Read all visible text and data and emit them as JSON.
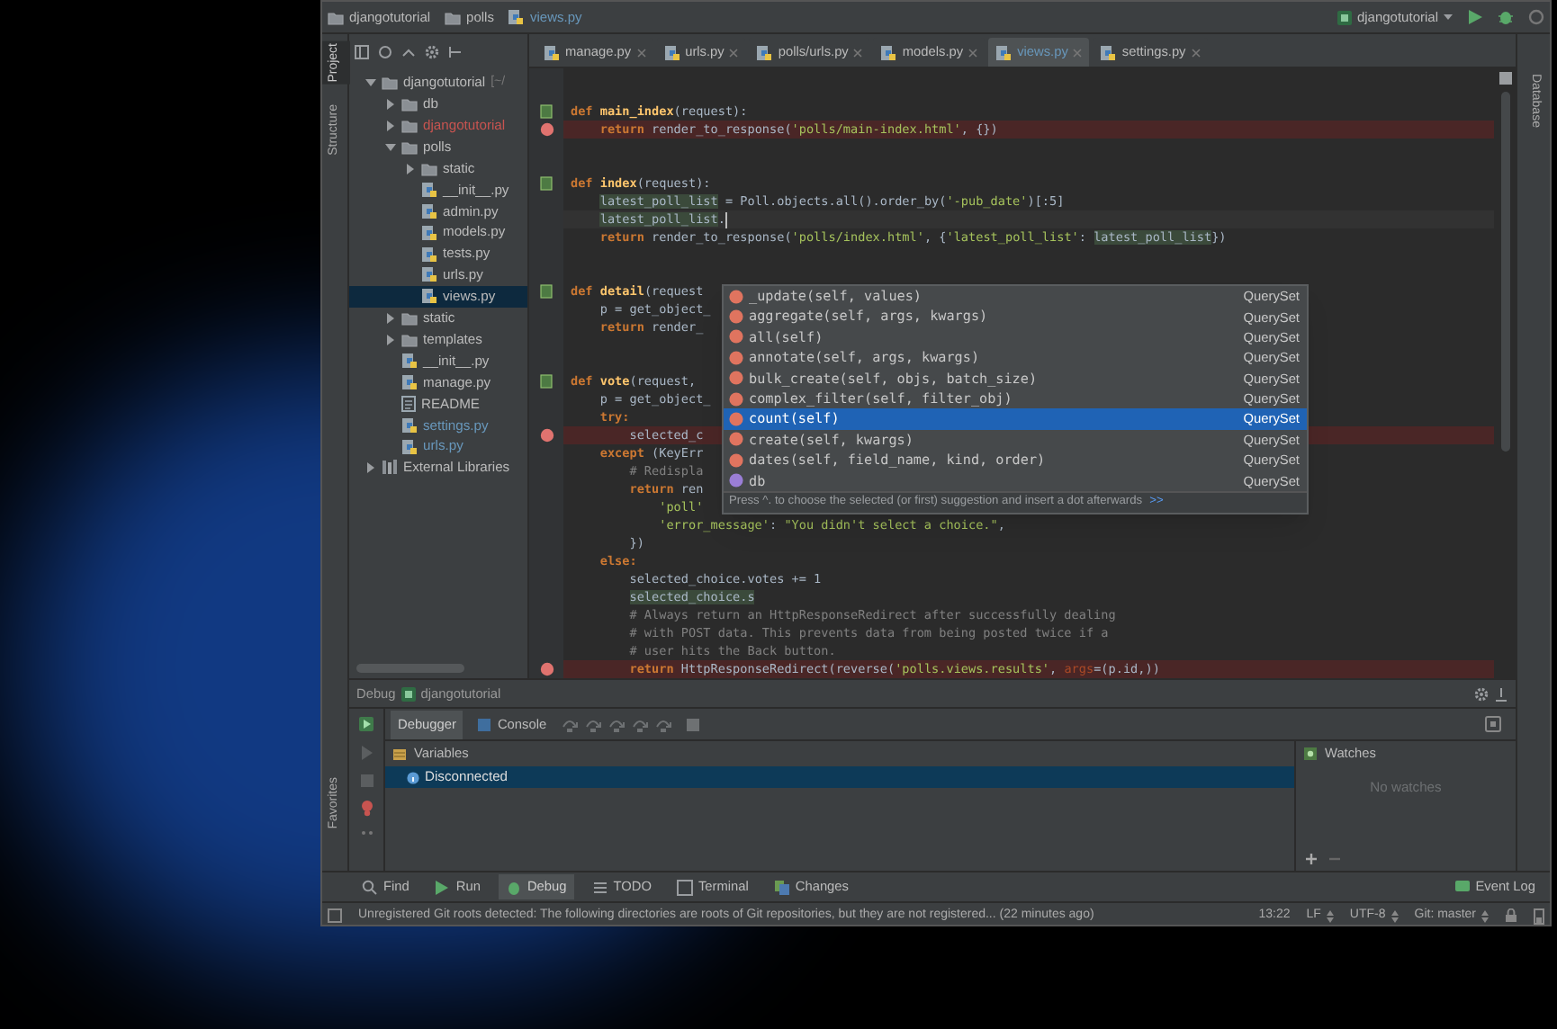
{
  "navbar": {
    "breadcrumbs": [
      {
        "label": "djangotutorial",
        "kind": "folder"
      },
      {
        "label": "polls",
        "kind": "folder"
      },
      {
        "label": "views.py",
        "kind": "python"
      }
    ],
    "run_config": "djangotutorial"
  },
  "left_tabs": [
    {
      "label": "Project",
      "selected": true
    },
    {
      "label": "Structure",
      "selected": false
    }
  ],
  "favorites_tab": "Favorites",
  "right_tabs": [
    "Database"
  ],
  "project_tree": [
    {
      "label": "djangotutorial",
      "path": "[~/",
      "kind": "folder",
      "expanded": true,
      "selected": false,
      "children": [
        {
          "label": "db",
          "kind": "folder",
          "expanded": false,
          "selected": false
        },
        {
          "label": "djangotutorial",
          "kind": "folder",
          "expanded": false,
          "selected": false,
          "color": "#c75450"
        },
        {
          "label": "polls",
          "kind": "folder",
          "expanded": true,
          "selected": false,
          "children": [
            {
              "label": "static",
              "kind": "folder",
              "expanded": false,
              "selected": false
            },
            {
              "label": "__init__.py",
              "kind": "python",
              "selected": false
            },
            {
              "label": "admin.py",
              "kind": "python",
              "selected": false
            },
            {
              "label": "models.py",
              "kind": "python",
              "selected": false
            },
            {
              "label": "tests.py",
              "kind": "python",
              "selected": false
            },
            {
              "label": "urls.py",
              "kind": "python",
              "selected": false
            },
            {
              "label": "views.py",
              "kind": "python",
              "selected": true
            }
          ]
        },
        {
          "label": "static",
          "kind": "folder",
          "expanded": false,
          "selected": false
        },
        {
          "label": "templates",
          "kind": "folder",
          "expanded": false,
          "selected": false
        },
        {
          "label": "__init__.py",
          "kind": "python",
          "selected": false
        },
        {
          "label": "manage.py",
          "kind": "python",
          "selected": false
        },
        {
          "label": "README",
          "kind": "text",
          "selected": false
        },
        {
          "label": "settings.py",
          "kind": "python",
          "selected": false,
          "color": "#6897bb"
        },
        {
          "label": "urls.py",
          "kind": "python",
          "selected": false,
          "color": "#6897bb"
        }
      ]
    },
    {
      "label": "External Libraries",
      "kind": "library",
      "expanded": false,
      "selected": false
    }
  ],
  "editor_tabs": [
    {
      "label": "manage.py",
      "selected": false
    },
    {
      "label": "urls.py",
      "selected": false
    },
    {
      "label": "polls/urls.py",
      "selected": false
    },
    {
      "label": "models.py",
      "selected": false
    },
    {
      "label": "views.py",
      "selected": true
    },
    {
      "label": "settings.py",
      "selected": false
    }
  ],
  "code_lines": [
    {
      "marker": true,
      "breakpoint": false,
      "current": false,
      "segments": [
        {
          "kind": "kw",
          "text": "def "
        },
        {
          "kind": "fn",
          "text": "main_index"
        },
        {
          "kind": "plain",
          "text": "(request):"
        }
      ]
    },
    {
      "marker": false,
      "breakpoint": true,
      "current": false,
      "segments": [
        {
          "kind": "kw",
          "text": "    return "
        },
        {
          "kind": "plain",
          "text": "render_to_response("
        },
        {
          "kind": "str",
          "text": "'polls/main-index.html'"
        },
        {
          "kind": "plain",
          "text": ", {})"
        }
      ]
    },
    {
      "marker": false,
      "breakpoint": false,
      "current": false
    },
    {
      "marker": false,
      "breakpoint": false,
      "current": false
    },
    {
      "marker": true,
      "breakpoint": false,
      "current": false,
      "segments": [
        {
          "kind": "kw",
          "text": "def "
        },
        {
          "kind": "fn",
          "text": "index"
        },
        {
          "kind": "plain",
          "text": "(request):"
        }
      ]
    },
    {
      "marker": false,
      "breakpoint": false,
      "current": false,
      "segments": [
        {
          "kind": "hl",
          "text": "    latest_poll_list"
        },
        {
          "kind": "plain",
          "text": " = Poll.objects.all().order_by("
        },
        {
          "kind": "str",
          "text": "'-pub_date'"
        },
        {
          "kind": "plain",
          "text": ")[:5]"
        }
      ]
    },
    {
      "marker": false,
      "breakpoint": false,
      "current": true,
      "segments": [
        {
          "kind": "hl",
          "text": "    latest_poll_list"
        },
        {
          "kind": "plain",
          "text": "."
        }
      ]
    },
    {
      "marker": false,
      "breakpoint": false,
      "current": false,
      "segments": [
        {
          "kind": "kw",
          "text": "    return "
        },
        {
          "kind": "plain",
          "text": "render_to_response("
        },
        {
          "kind": "str",
          "text": "'polls/index.html'"
        },
        {
          "kind": "plain",
          "text": ", {"
        },
        {
          "kind": "str",
          "text": "'latest_poll_list'"
        },
        {
          "kind": "plain",
          "text": ": "
        },
        {
          "kind": "hl",
          "text": "latest_poll_list"
        },
        {
          "kind": "plain",
          "text": "})"
        }
      ]
    },
    {
      "marker": false,
      "breakpoint": false,
      "current": false
    },
    {
      "marker": false,
      "breakpoint": false,
      "current": false
    },
    {
      "marker": true,
      "breakpoint": false,
      "current": false,
      "segments": [
        {
          "kind": "kw",
          "text": "def "
        },
        {
          "kind": "fn",
          "text": "detail"
        },
        {
          "kind": "plain",
          "text": "(request"
        }
      ]
    },
    {
      "marker": false,
      "breakpoint": false,
      "current": false,
      "segments": [
        {
          "kind": "plain",
          "text": "    p = get_object_"
        }
      ]
    },
    {
      "marker": false,
      "breakpoint": false,
      "current": false,
      "segments": [
        {
          "kind": "kw",
          "text": "    return "
        },
        {
          "kind": "plain",
          "text": "render_"
        }
      ]
    },
    {
      "marker": false,
      "breakpoint": false,
      "current": false
    },
    {
      "marker": false,
      "breakpoint": false,
      "current": false
    },
    {
      "marker": true,
      "breakpoint": false,
      "current": false,
      "segments": [
        {
          "kind": "kw",
          "text": "def "
        },
        {
          "kind": "fn",
          "text": "vote"
        },
        {
          "kind": "plain",
          "text": "(request,"
        }
      ]
    },
    {
      "marker": false,
      "breakpoint": false,
      "current": false,
      "segments": [
        {
          "kind": "plain",
          "text": "    p = get_object_"
        }
      ]
    },
    {
      "marker": false,
      "breakpoint": false,
      "current": false,
      "segments": [
        {
          "kind": "kw",
          "text": "    try:"
        }
      ]
    },
    {
      "marker": false,
      "breakpoint": true,
      "current": false,
      "segments": [
        {
          "kind": "plain",
          "text": "        selected_c"
        }
      ]
    },
    {
      "marker": false,
      "breakpoint": false,
      "current": false,
      "segments": [
        {
          "kind": "kw",
          "text": "    except "
        },
        {
          "kind": "plain",
          "text": "(KeyErr"
        }
      ]
    },
    {
      "marker": false,
      "breakpoint": false,
      "current": false,
      "segments": [
        {
          "kind": "cmt",
          "text": "        # Redispla"
        }
      ]
    },
    {
      "marker": false,
      "breakpoint": false,
      "current": false,
      "segments": [
        {
          "kind": "kw",
          "text": "        return "
        },
        {
          "kind": "plain",
          "text": "ren"
        }
      ]
    },
    {
      "marker": false,
      "breakpoint": false,
      "current": false,
      "segments": [
        {
          "kind": "str",
          "text": "            'poll'"
        }
      ]
    },
    {
      "marker": false,
      "breakpoint": false,
      "current": false,
      "segments": [
        {
          "kind": "str",
          "text": "            'error_message'"
        },
        {
          "kind": "plain",
          "text": ": "
        },
        {
          "kind": "str",
          "text": "\"You didn't select a choice.\""
        },
        {
          "kind": "plain",
          "text": ","
        }
      ]
    },
    {
      "marker": false,
      "breakpoint": false,
      "current": false,
      "segments": [
        {
          "kind": "plain",
          "text": "        })"
        }
      ]
    },
    {
      "marker": false,
      "breakpoint": false,
      "current": false,
      "segments": [
        {
          "kind": "kw",
          "text": "    else:"
        }
      ]
    },
    {
      "marker": false,
      "breakpoint": false,
      "current": false,
      "segments": [
        {
          "kind": "plain",
          "text": "        selected_choice.votes += 1"
        }
      ]
    },
    {
      "marker": false,
      "breakpoint": false,
      "current": false,
      "segments": [
        {
          "kind": "hl",
          "text": "        selected_choice.s"
        }
      ]
    },
    {
      "marker": false,
      "breakpoint": false,
      "current": false,
      "segments": [
        {
          "kind": "cmt",
          "text": "        # Always return an HttpResponseRedirect after successfully dealing"
        }
      ]
    },
    {
      "marker": false,
      "breakpoint": false,
      "current": false,
      "segments": [
        {
          "kind": "cmt",
          "text": "        # with POST data. This prevents data from being posted twice if a"
        }
      ]
    },
    {
      "marker": false,
      "breakpoint": false,
      "current": false,
      "segments": [
        {
          "kind": "cmt",
          "text": "        # user hits the Back button."
        }
      ]
    },
    {
      "marker": false,
      "breakpoint": true,
      "current": false,
      "segments": [
        {
          "kind": "kw",
          "text": "        return "
        },
        {
          "kind": "plain",
          "text": "HttpResponseRedirect(reverse("
        },
        {
          "kind": "str",
          "text": "'polls.views.results'"
        },
        {
          "kind": "plain",
          "text": ", "
        },
        {
          "kind": "param",
          "text": "args"
        },
        {
          "kind": "plain",
          "text": "=(p.id,))"
        }
      ]
    }
  ],
  "completion": {
    "items": [
      {
        "name": "_update(self, values)",
        "type": "QuerySet",
        "kind": "method",
        "selected": false
      },
      {
        "name": "aggregate(self, args, kwargs)",
        "type": "QuerySet",
        "kind": "method",
        "selected": false
      },
      {
        "name": "all(self)",
        "type": "QuerySet",
        "kind": "method",
        "selected": false
      },
      {
        "name": "annotate(self, args, kwargs)",
        "type": "QuerySet",
        "kind": "method",
        "selected": false
      },
      {
        "name": "bulk_create(self, objs, batch_size)",
        "type": "QuerySet",
        "kind": "method",
        "selected": false
      },
      {
        "name": "complex_filter(self, filter_obj)",
        "type": "QuerySet",
        "kind": "method",
        "selected": false
      },
      {
        "name": "count(self)",
        "type": "QuerySet",
        "kind": "method",
        "selected": true
      },
      {
        "name": "create(self, kwargs)",
        "type": "QuerySet",
        "kind": "method",
        "selected": false
      },
      {
        "name": "dates(self, field_name, kind, order)",
        "type": "QuerySet",
        "kind": "method",
        "selected": false
      },
      {
        "name": "db",
        "type": "QuerySet",
        "kind": "property",
        "selected": false
      }
    ],
    "hint": "Press ^. to choose the selected (or first) suggestion and insert a dot afterwards",
    "hint_link": ">>"
  },
  "debug": {
    "title": "Debug",
    "config": "djangotutorial",
    "tabs": [
      {
        "label": "Debugger",
        "selected": true
      },
      {
        "label": "Console",
        "selected": false
      }
    ],
    "variables_title": "Variables",
    "variables": [
      {
        "label": "Disconnected",
        "selected": true
      }
    ],
    "watches_title": "Watches",
    "watches_empty": "No watches"
  },
  "tool_buttons": [
    {
      "label": "Find",
      "kind": "find",
      "selected": false
    },
    {
      "label": "Run",
      "kind": "run",
      "selected": false
    },
    {
      "label": "Debug",
      "kind": "debug",
      "selected": true
    },
    {
      "label": "TODO",
      "kind": "todo",
      "selected": false
    },
    {
      "label": "Terminal",
      "kind": "terminal",
      "selected": false
    },
    {
      "label": "Changes",
      "kind": "changes",
      "selected": false
    }
  ],
  "event_log": "Event Log",
  "status_bar": {
    "message": "Unregistered Git roots detected: The following directories are roots of Git repositories, but they are not registered... (22 minutes ago)",
    "position": "13:22",
    "line_ending": "LF",
    "encoding": "UTF-8",
    "vcs": "Git: master"
  }
}
